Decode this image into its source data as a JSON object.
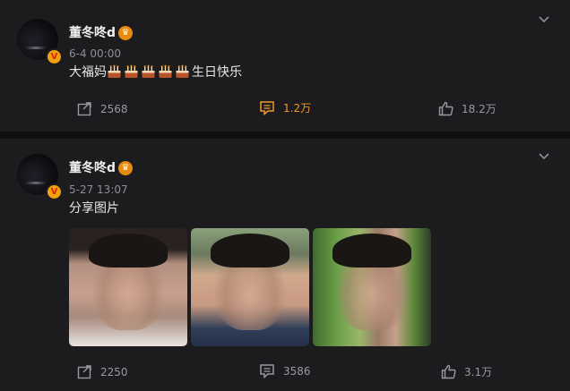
{
  "posts": [
    {
      "username": "董冬咚d",
      "time": "6-4 00:00",
      "text_prefix": "大福妈",
      "cake_count": 5,
      "text_suffix": "生日快乐",
      "repost_count": "2568",
      "comment_count": "1.2万",
      "like_count": "18.2万",
      "comment_active": true
    },
    {
      "username": "董冬咚d",
      "time": "5-27 13:07",
      "text": "分享图片",
      "photos": 3,
      "repost_count": "2250",
      "comment_count": "3586",
      "like_count": "3.1万"
    }
  ],
  "icons": {
    "verified_badge": "v-badge",
    "member_crown": "crown-icon",
    "menu": "chevron-down-icon",
    "repost": "repost-icon",
    "comment": "comment-icon",
    "like": "thumbs-up-icon",
    "cake": "cake-emoji"
  },
  "colors": {
    "accent": "#f09a29",
    "background": "#1c1c1f",
    "separator": "#0f0f11"
  }
}
